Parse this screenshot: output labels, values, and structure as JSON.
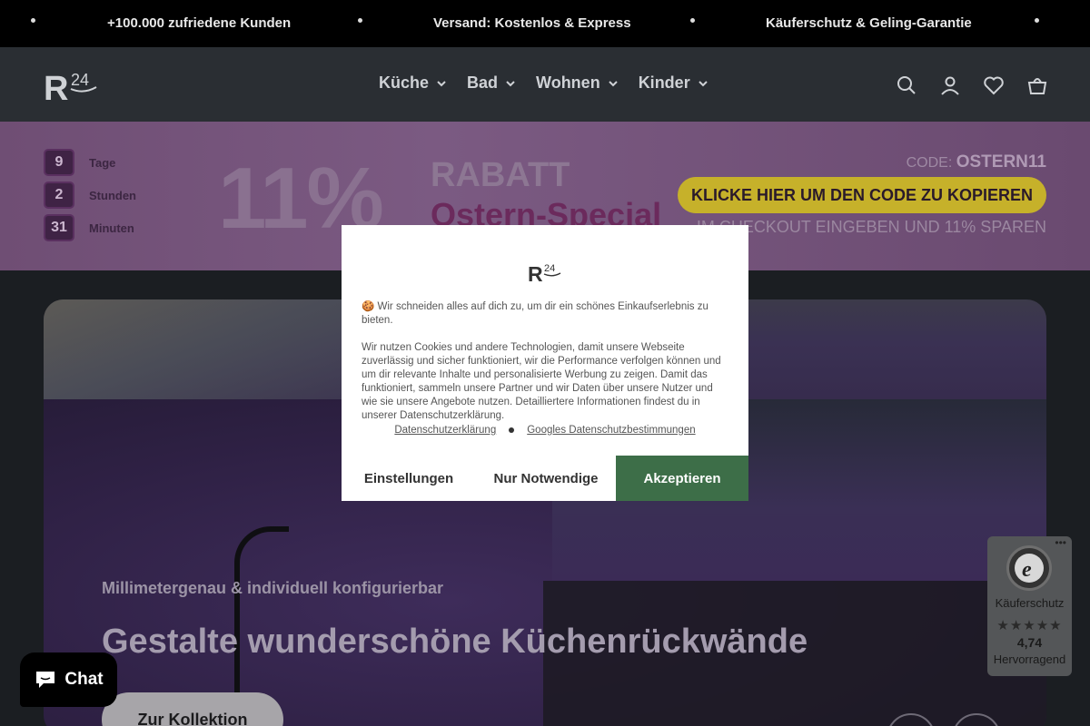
{
  "announcement": {
    "messages": [
      "+100.000 zufriedene Kunden",
      "Versand: Kostenlos & Express",
      "Käuferschutz & Geling-Garantie"
    ]
  },
  "header": {
    "logo_text": "R24",
    "nav": [
      {
        "label": "Küche"
      },
      {
        "label": "Bad"
      },
      {
        "label": "Wohnen"
      },
      {
        "label": "Kinder"
      }
    ],
    "icons": [
      "search-icon",
      "account-icon",
      "wishlist-icon",
      "cart-icon"
    ]
  },
  "promo": {
    "countdown": [
      {
        "value": "9",
        "label": "Tage"
      },
      {
        "value": "2",
        "label": "Stunden"
      },
      {
        "value": "31",
        "label": "Minuten"
      }
    ],
    "percent": "11%",
    "rabatt": "RABATT",
    "subtitle": "Ostern-Special",
    "code_label": "CODE:",
    "code": "OSTERN11",
    "copy_button": "KLICKE HIER UM DEN CODE ZU KOPIEREN",
    "hint": "IM CHECKOUT EINGEBEN UND 11% SPAREN"
  },
  "hero": {
    "subtitle": "Millimetergenau & individuell konfigurierbar",
    "title": "Gestalte wunderschöne Küchenrückwände",
    "button": "Zur Kollektion"
  },
  "cookie": {
    "logo_text": "R24",
    "text1": "🍪 Wir schneiden alles auf dich zu, um dir ein schönes Einkaufserlebnis zu bieten.",
    "text2": "Wir nutzen Cookies und andere Technologien, damit unsere Webseite zuverlässig und sicher funktioniert, wir die Performance verfolgen können und um dir relevante Inhalte und personalisierte Werbung zu zeigen. Damit das funktioniert, sammeln unsere Partner und wir Daten über unsere Nutzer und wie sie unsere Angebote nutzen. Detailliertere Informationen findest du in unserer Datenschutzerklärung.",
    "link1": "Datenschutzerklärung",
    "link2": "Googles Datenschutzbestimmungen",
    "btn_settings": "Einstellungen",
    "btn_needed": "Nur Notwendige",
    "btn_accept": "Akzeptieren",
    "accept_color": "#3d6e48"
  },
  "chat": {
    "label": "Chat"
  },
  "trust": {
    "label": "Käuferschutz",
    "stars": "★★★★★",
    "score": "4,74",
    "rating": "Hervorragend"
  }
}
